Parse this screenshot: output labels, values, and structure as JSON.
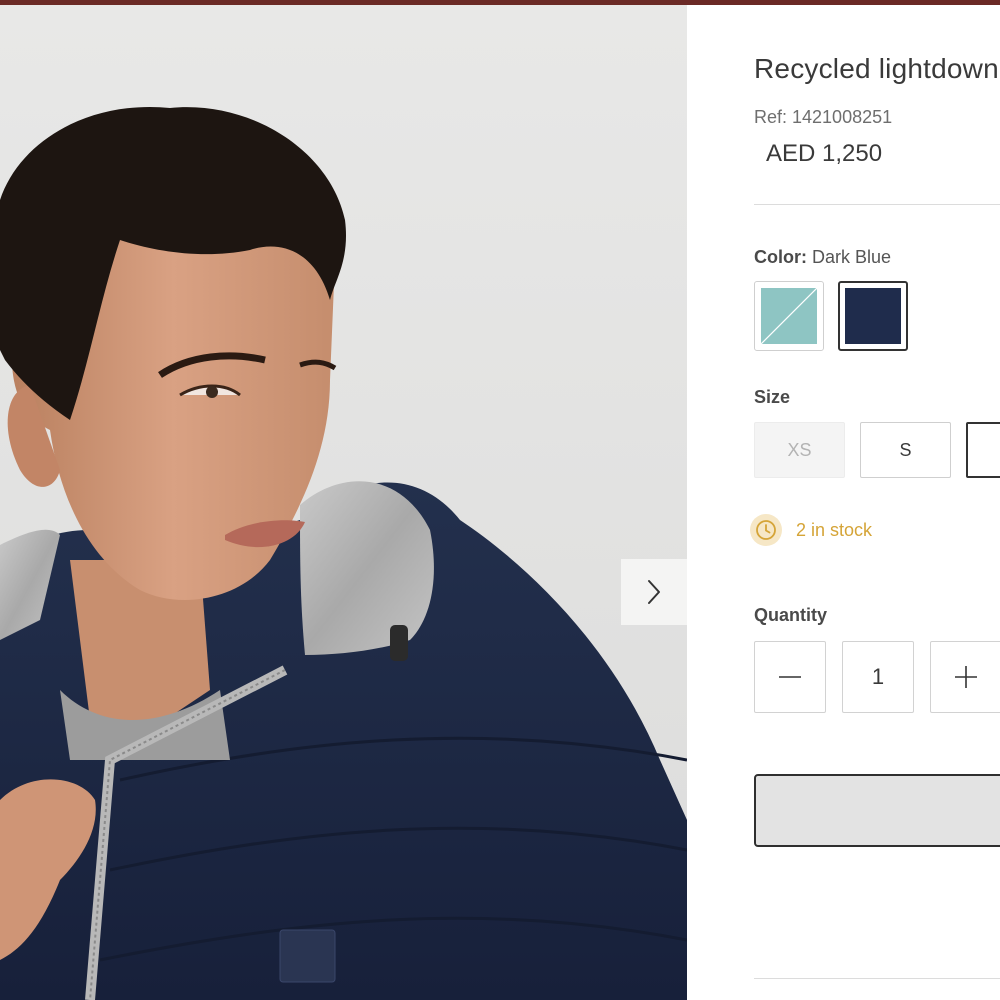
{
  "product": {
    "title": "Recycled lightdown",
    "ref": "Ref: 1421008251",
    "price": "AED 1,250"
  },
  "gallery": {
    "image_alt": "Model wearing dark blue hooded puffer jacket",
    "next_icon": "chevron-right-icon"
  },
  "color": {
    "label": "Color:",
    "selected": "Dark Blue",
    "swatches": [
      {
        "name": "mint",
        "hex": "#8ec5c3",
        "available": false
      },
      {
        "name": "Dark Blue",
        "hex": "#1f2c4c",
        "available": true,
        "selected": true
      }
    ]
  },
  "size": {
    "label": "Size",
    "options": [
      {
        "label": "XS",
        "available": false
      },
      {
        "label": "S",
        "available": true
      },
      {
        "label": "",
        "available": true,
        "selected": true
      }
    ]
  },
  "stock": {
    "icon": "clock-icon",
    "text": "2 in stock",
    "color": "#d5a437"
  },
  "quantity": {
    "label": "Quantity",
    "value": "1",
    "minus_icon": "minus-icon",
    "plus_icon": "plus-icon"
  },
  "colors": {
    "accent_bar": "#6b2a26",
    "jacket": "#1f2a44",
    "stock_text": "#d5a437",
    "stock_icon_bg": "#f6e7c6"
  }
}
